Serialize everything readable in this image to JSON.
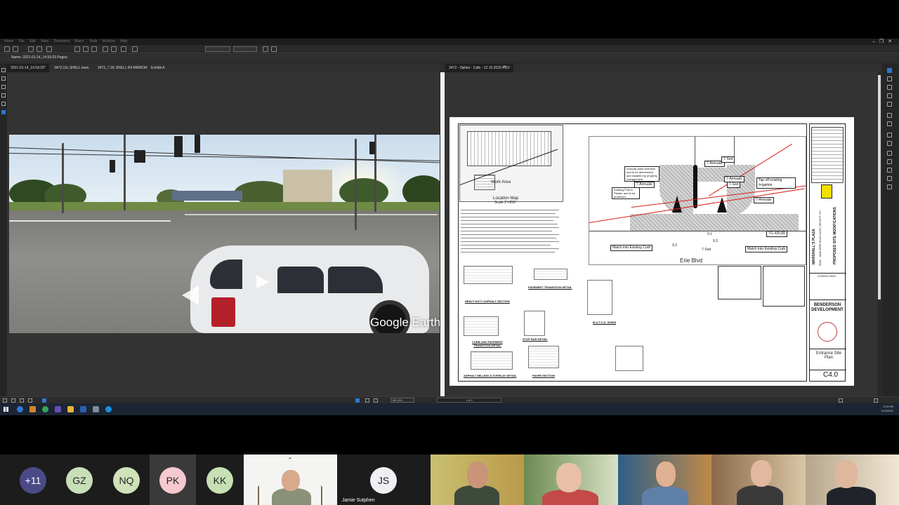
{
  "app": {
    "menu": [
      "Home",
      "File",
      "Edit",
      "View",
      "Document",
      "Batch",
      "Tools",
      "Window",
      "Help"
    ],
    "properties_label": "Name: 2021-01-14_14.59.03   Pages:",
    "tabs_left": [
      "2021-01-14_14.59.03*",
      "3472.13c SHELL town",
      "3472_7.1K SHELL R4 MIRROR",
      "Exhibit A"
    ],
    "tab_right": "3472 - Option - Cafe - 12.15.2020.4.EV",
    "zoom": "86.13%",
    "page_indicator": "1 of 1"
  },
  "street_view": {
    "watermark": "Google Earth"
  },
  "drawing": {
    "location_map_title": "Location Map",
    "location_map_scale": "Scale 1\"=250'",
    "work_area_label": "Work Area",
    "road_label": "Erie Blvd",
    "callouts": {
      "annuals_top": "7-Annuals",
      "sod_top": "7-Sod",
      "annuals_mid": "7-Annuals",
      "sod_mid": "7-Sod",
      "annuals_right": "7-Annuals",
      "tap_irrigation": "Tap off existing Irrigation",
      "annuals_left": "7-Annuals",
      "existing_pole": "Existing Pole in Planter and to be protected",
      "plant_selection": "Annuals plant selection and to be determined and installed by property management",
      "tg_elev": "TG 435.89",
      "match_left": "Match into Existing Curb",
      "match_right": "Match into Existing Curb",
      "sod_bottom": "7-Sod",
      "dim_1": "9.3",
      "dim_2": "9.1",
      "dim_3": "9.3"
    },
    "details": {
      "heavy_duty": "HEAVY DUTY ASPHALT SECTION",
      "pavement_transition": "PAVEMENT TRANSITION DETAIL",
      "mutcd": "M.U.T.C.D. SIGNS",
      "curb_pavement": "CURB AND PAVEMENT TRANSITION DETAIL",
      "stop_bar": "STOP BAR DETAIL",
      "milling": "ASPHALT MILLING & OVERLAY DETAIL",
      "paver": "PAVER SECTION"
    },
    "title_block": {
      "project": "MARSHALL'S PLAZA",
      "project_address": "3001 - 3049 ERIE BLVD EAST, DEWITT, NY",
      "sheet_title_vertical": "PROPOSED SITE MODIFICATIONS",
      "consultant": "CONSULTANT",
      "company": "BENDERSON DEVELOPMENT",
      "sheet_name": "Entrance Site Plan",
      "sheet_number": "C4.0"
    }
  },
  "taskbar": {
    "clock": "2:53 PM",
    "date": "1/14/2021"
  },
  "participants": [
    {
      "initials": "+11",
      "color": "#4b4a86"
    },
    {
      "initials": "GZ",
      "color": "#c7dfb7"
    },
    {
      "initials": "NQ",
      "color": "#cfe2b8"
    },
    {
      "initials": "PK",
      "color": "#f5c9cf"
    },
    {
      "initials": "KK",
      "color": "#c6dfb4"
    }
  ],
  "jamie": {
    "initials": "JS",
    "name": "Jamie Sutphen"
  }
}
